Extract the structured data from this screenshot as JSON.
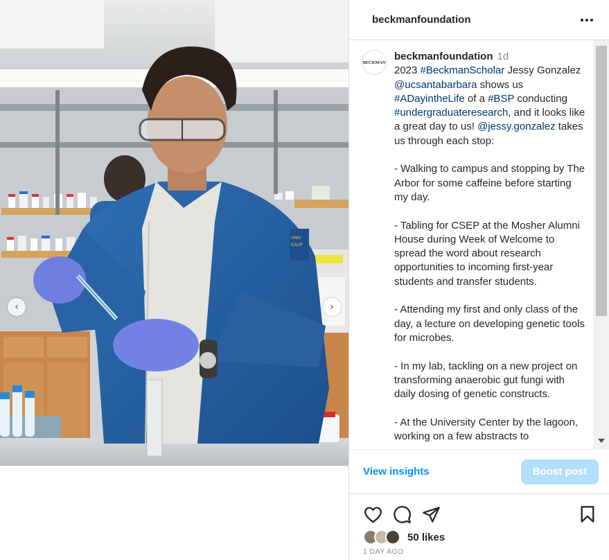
{
  "post": {
    "username": "beckmanfoundation",
    "avatar_text": "BECKMAN",
    "time_ago": "1d",
    "caption": {
      "line_year": "2023 ",
      "tag_scholar": "#BeckmanScholar",
      "t1": " Jessy Gonzalez ",
      "mention_school": "@ucsantabarbara",
      "t2": " shows us ",
      "tag_day": "#ADayintheLife",
      "t3": " of a ",
      "tag_bsp": "#BSP",
      "t4": " conducting ",
      "tag_research": "#undergraduateresearch",
      "t5": ", and it looks like a great day to us! ",
      "mention_user": "@jessy.gonzalez",
      "t6": " takes us through each stop:",
      "stops": [
        "- Walking to campus and stopping by The Arbor for some caffeine before starting my day.",
        "- Tabling for CSEP at the Mosher Alumni House during Week of Welcome to spread the word about research opportunities to incoming first-year students and transfer students.",
        "- Attending my first and only class of the day, a lecture on developing genetic tools for microbes.",
        "- In my lab, tackling on a new project on transforming anaerobic gut fungi with daily dosing of genetic constructs.",
        "- At the University Center by the lagoon, working on a few abstracts to"
      ]
    },
    "insights_label": "View insights",
    "boost_label": "Boost post",
    "likes_label": "50 likes",
    "date_label": "1 DAY AGO",
    "icons": [
      "more-icon",
      "heart-icon",
      "comment-icon",
      "share-icon",
      "bookmark-icon",
      "chevron-left-icon",
      "chevron-right-icon"
    ],
    "colors": {
      "link": "#00376b",
      "accent": "#0095f6",
      "boost_bg": "#b2dffc",
      "border": "#dbdbdb",
      "muted": "#8e8e8e"
    }
  }
}
